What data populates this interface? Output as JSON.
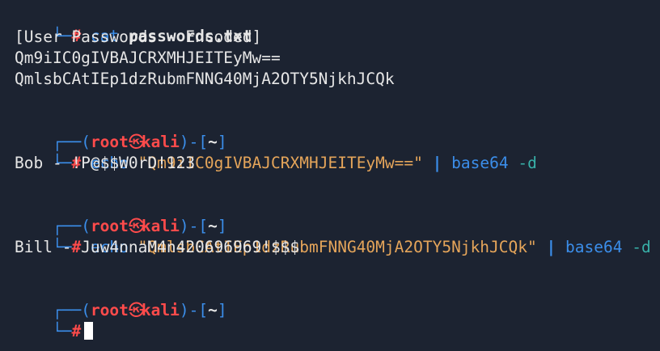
{
  "colors": {
    "background": "#1c2331",
    "prompt_frame": "#3b8eea",
    "user_host": "#ff4b4b",
    "command": "#3b8eea",
    "string": "#e5a55a",
    "flag": "#38b0a8",
    "text": "#e6e6e6"
  },
  "prompt": {
    "top_left": "┌──(",
    "user": "root",
    "skull": "㉿",
    "host": "kali",
    "close_open": ")-[",
    "path": "~",
    "close": "]",
    "bottom_left": "└─",
    "hash": "#"
  },
  "lines": {
    "l1_cmd": "cat",
    "l1_arg": "passwords.txt",
    "l2": "[User Passwords - Encoded]",
    "l3": "Qm9iIC0gIVBAJCRXMHJEITEyMw==",
    "l4": "QmlsbCAtIEp1dzRubmFNNG40MjA2OTY5NjkhJCQk",
    "l6_cmd": "echo",
    "l6_arg": "\"Qm9iIC0gIVBAJCRXMHJEITEyMw==\"",
    "l6_pipe": "|",
    "l6_tool": "base64",
    "l6_flag": "-d",
    "l7": "Bob - !P@$$W0rD!123",
    "l9_cmd": "echo",
    "l9_arg": "\"QmlsbCAtIEp1dzRubmFNNG40MjA2OTY5NjkhJCQk\"",
    "l9_pipe": "|",
    "l9_tool": "base64",
    "l9_flag": "-d",
    "l10": "Bill - Juw4nnaM4n420696969!$$$"
  }
}
